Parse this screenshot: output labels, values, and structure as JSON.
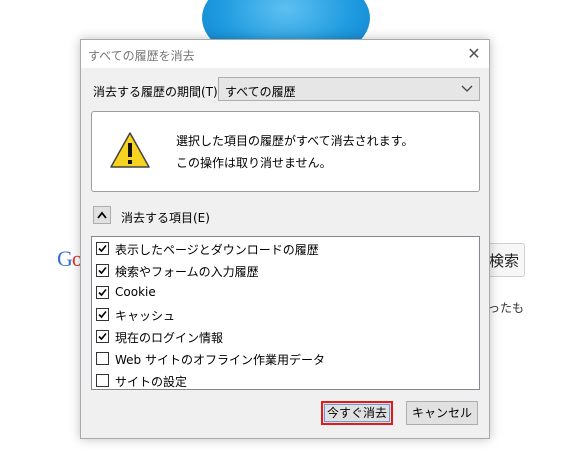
{
  "dialog": {
    "title": "すべての履歴を消去",
    "period_label": "消去する履歴の期間(T):",
    "period_value": "すべての履歴",
    "warning_line1": "選択した項目の履歴がすべて消去されます。",
    "warning_line2": "この操作は取り消せません。",
    "items_label": "消去する項目(E)",
    "items": [
      {
        "label": "表示したページとダウンロードの履歴",
        "checked": true
      },
      {
        "label": "検索やフォームの入力履歴",
        "checked": true
      },
      {
        "label": "Cookie",
        "checked": true
      },
      {
        "label": "キャッシュ",
        "checked": true
      },
      {
        "label": "現在のログイン情報",
        "checked": true
      },
      {
        "label": "Web サイトのオフライン作業用データ",
        "checked": false
      },
      {
        "label": "サイトの設定",
        "checked": false
      }
    ],
    "clear_button": "今すぐ消去",
    "cancel_button": "キャンセル"
  },
  "background": {
    "google_part1": "G",
    "google_part2": "o",
    "search_button": "検索",
    "note": "ったも"
  },
  "colors": {
    "highlight_border": "#dd1c1c",
    "warning_yellow": "#f5d31f"
  }
}
